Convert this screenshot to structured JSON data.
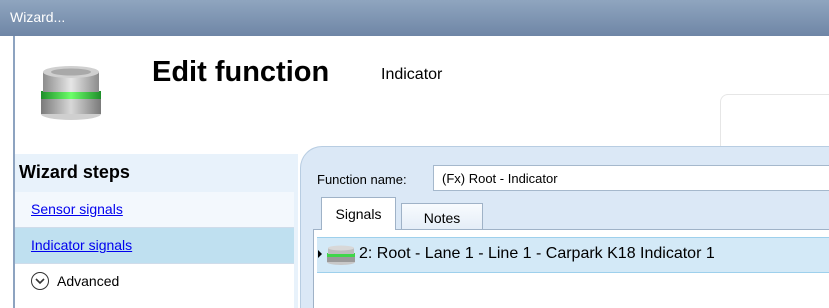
{
  "window": {
    "title": "Wizard..."
  },
  "header": {
    "title": "Edit function",
    "subtitle": "Indicator",
    "icon": "indicator-light-icon"
  },
  "sidebar": {
    "heading": "Wizard steps",
    "items": [
      {
        "label": "Sensor signals",
        "type": "link"
      },
      {
        "label": "Indicator signals",
        "type": "link",
        "selected": true
      },
      {
        "label": "Advanced",
        "type": "expander",
        "icon": "chevron-down-circle-icon"
      }
    ]
  },
  "main": {
    "function_name_label": "Function name:",
    "function_name_value": "(Fx) Root - Indicator",
    "tabs": [
      {
        "label": "Signals",
        "active": true
      },
      {
        "label": "Notes",
        "active": false
      }
    ],
    "signals": [
      {
        "icon": "indicator-light-icon",
        "label": "2: Root - Lane 1 - Line 1 - Carpark K18 Indicator 1",
        "selected": true
      }
    ]
  },
  "colors": {
    "titlebar": "#7f96b3",
    "sidebar_bg": "#e8f2fb",
    "selected_step": "#bfe0f0",
    "content_bg": "#dbe8f6",
    "selected_row": "#d3e9f7",
    "indicator_green": "#2fcf3c"
  }
}
